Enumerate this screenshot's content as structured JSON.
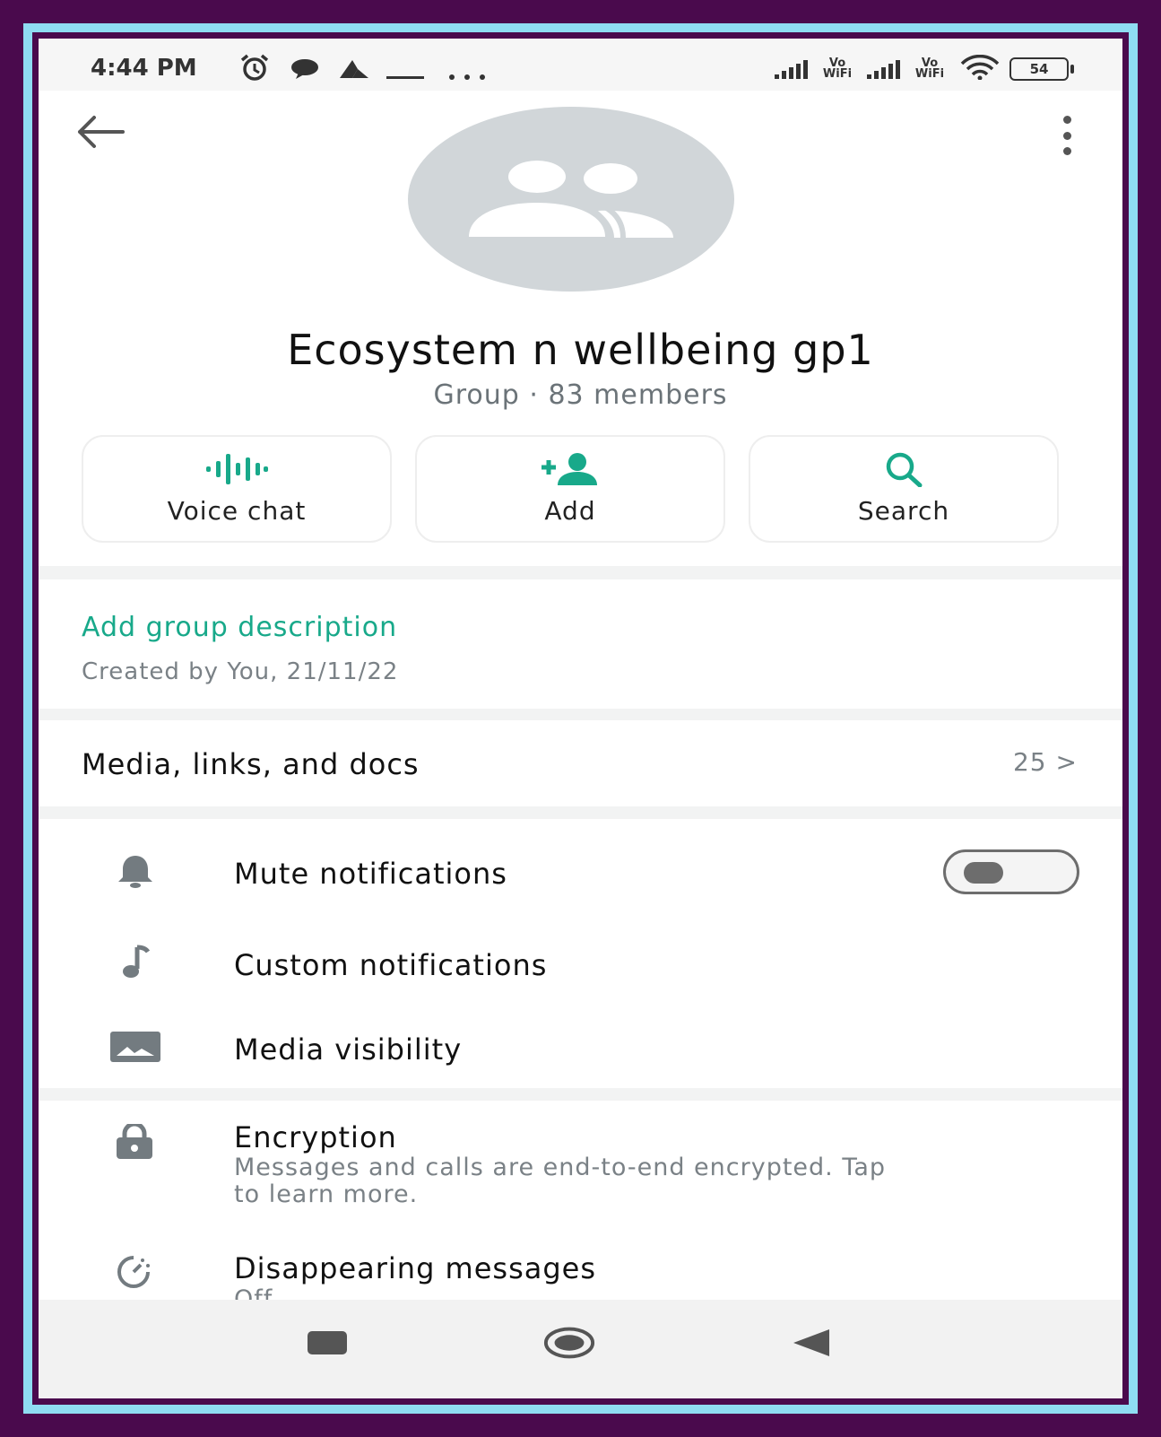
{
  "status_bar": {
    "time": "4:44 PM",
    "vowifi_1": "Vo WiFi",
    "vowifi_2": "Vo WiFi",
    "battery": "54",
    "icons": [
      "alarm-icon",
      "chat-bubble-icon",
      "nav-arrow-icon",
      "dash-icon",
      "more-dots-icon",
      "signal-icon",
      "wifi-icon",
      "battery-icon"
    ]
  },
  "header": {
    "group_name": "Ecosystem n wellbeing gp1",
    "group_type": "Group",
    "separator": "·",
    "members": "83 members",
    "icons": [
      "back-arrow-icon",
      "overflow-menu-icon",
      "group-avatar-icon"
    ]
  },
  "actions": [
    {
      "label": "Voice chat",
      "icon": "voice-wave-icon"
    },
    {
      "label": "Add",
      "icon": "add-person-icon"
    },
    {
      "label": "Search",
      "icon": "search-icon"
    }
  ],
  "description": {
    "add_label": "Add group description",
    "created": "Created by You, 21/11/22"
  },
  "media": {
    "label": "Media, links, and docs",
    "count": "25",
    "chevron": ">"
  },
  "settings": [
    {
      "label": "Mute notifications",
      "icon": "bell-icon"
    },
    {
      "label": "Custom notifications",
      "icon": "music-note-icon"
    },
    {
      "label": "Media visibility",
      "icon": "image-icon"
    }
  ],
  "mute_toggle_on": false,
  "security": {
    "encryption_label": "Encryption",
    "encryption_sub": "Messages and calls are end-to-end encrypted. Tap to learn more.",
    "disappearing_label": "Disappearing messages",
    "disappearing_sub": "Off"
  },
  "colors": {
    "accent": "#18a98a",
    "frame_outer": "#4a0a4d",
    "frame_border": "#8fdcf2",
    "avatar_bg": "#d1d6d9"
  }
}
